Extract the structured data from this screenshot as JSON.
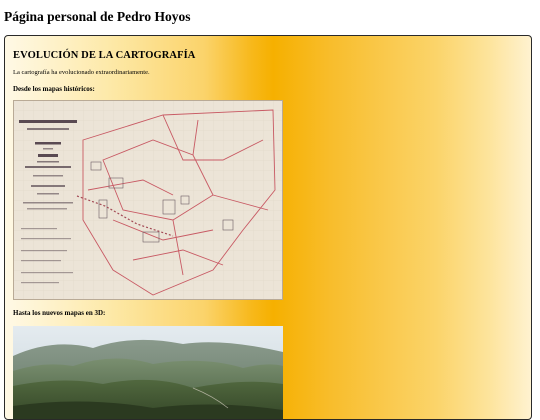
{
  "page": {
    "title": "Página personal de Pedro Hoyos"
  },
  "section": {
    "title": "EVOLUCIÓN DE LA CARTOGRAFÍA",
    "intro": "La cartografía ha evolucionado extraordinariamente.",
    "historic_label": "Desde los mapas históricos:",
    "modern_label": "Hasta los nuevos mapas en 3D:"
  },
  "historic_map": {
    "heading_lines": [
      "INSTITUTO GEOGRÁFICO-ESTADÍSTICO",
      "TRABAJOS TOPOGRÁFICOS",
      "PROVINCIA",
      "de",
      "TOLEDO",
      "Municipio",
      "VALDEPIÉDOLA ROCA"
    ]
  },
  "colors": {
    "panel_center": "#f6b000",
    "panel_edge": "#fff2d0",
    "old_paper": "#e9e1d4",
    "map_red_lines": "#c85a64"
  }
}
